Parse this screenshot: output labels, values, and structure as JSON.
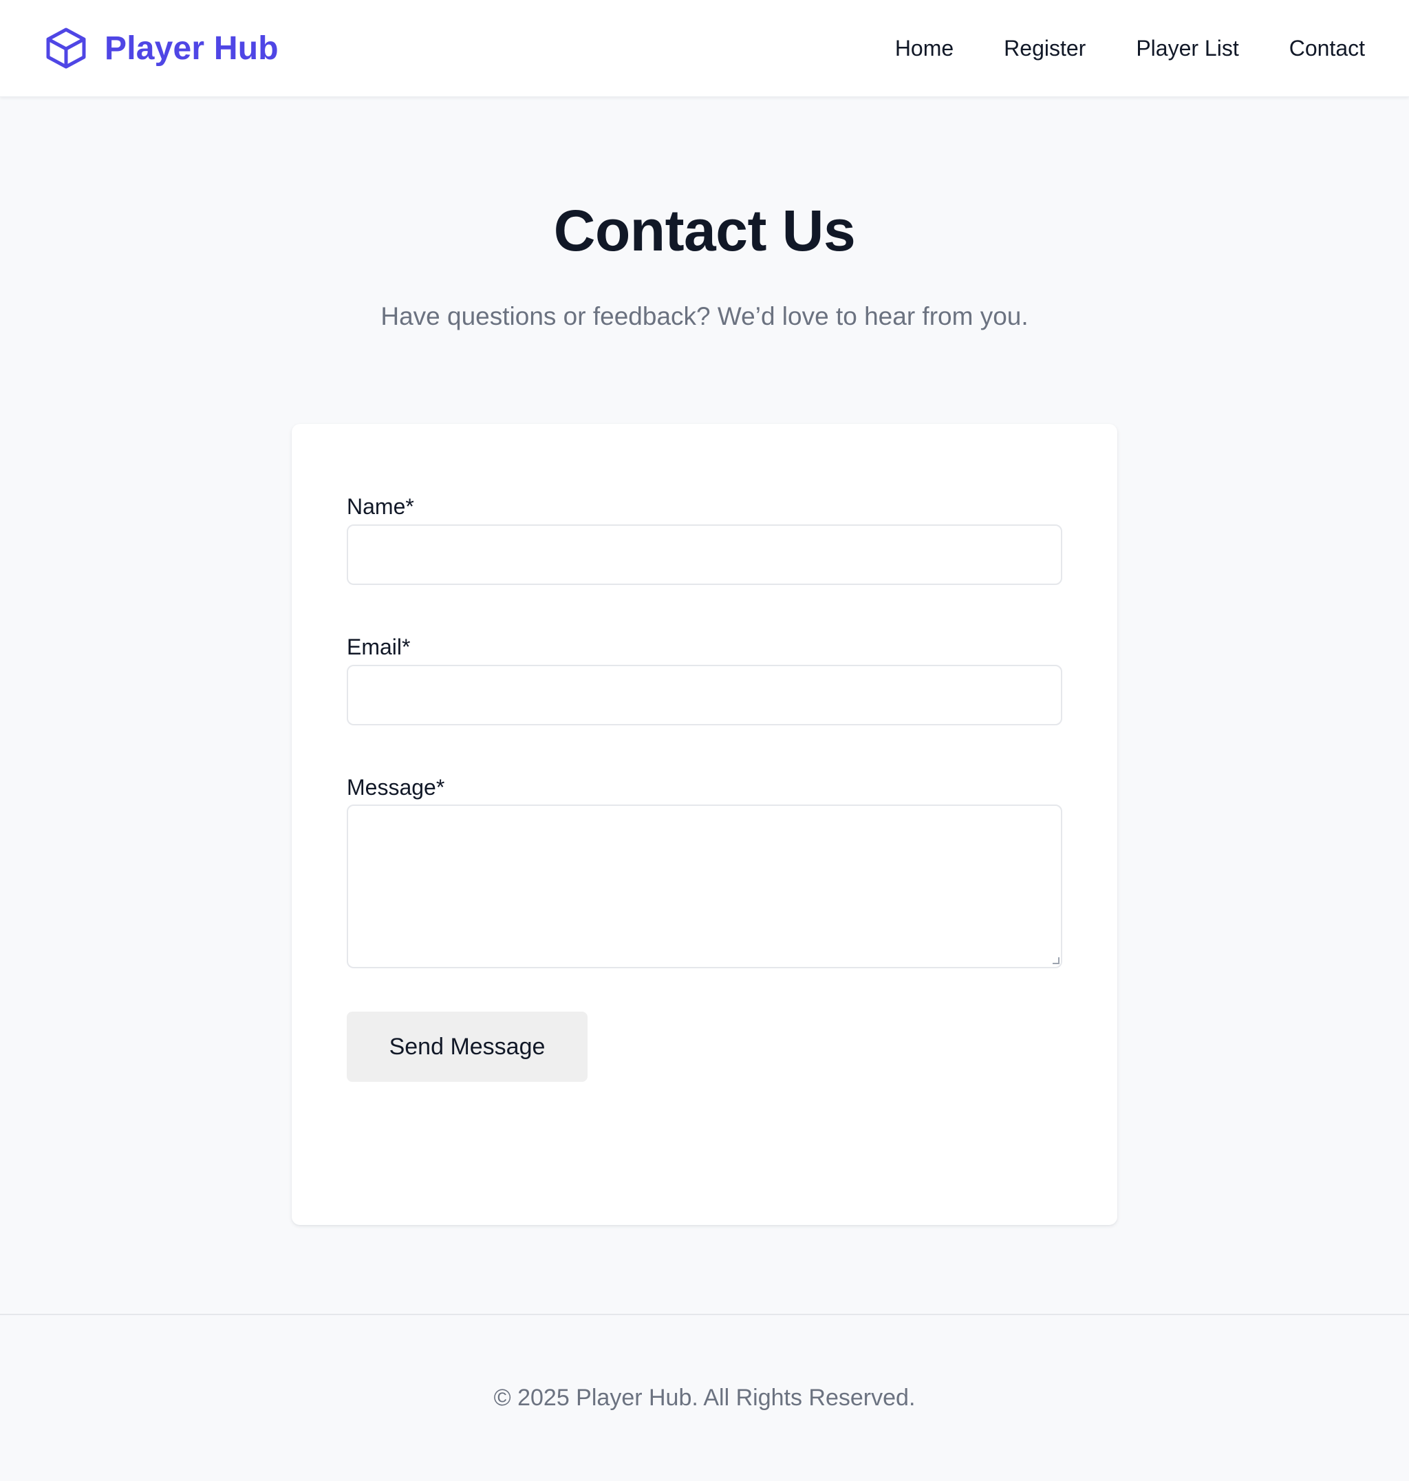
{
  "header": {
    "brand_name": "Player Hub",
    "brand_icon": "cube-icon",
    "brand_color": "#4f46e5",
    "nav": [
      {
        "label": "Home"
      },
      {
        "label": "Register"
      },
      {
        "label": "Player List"
      },
      {
        "label": "Contact"
      }
    ]
  },
  "hero": {
    "title": "Contact Us",
    "subtitle": "Have questions or feedback? We’d love to hear from you."
  },
  "form": {
    "name_label": "Name*",
    "name_value": "",
    "email_label": "Email*",
    "email_value": "",
    "message_label": "Message*",
    "message_value": "",
    "submit_label": "Send Message"
  },
  "footer": {
    "text": "© 2025 Player Hub. All Rights Reserved."
  }
}
